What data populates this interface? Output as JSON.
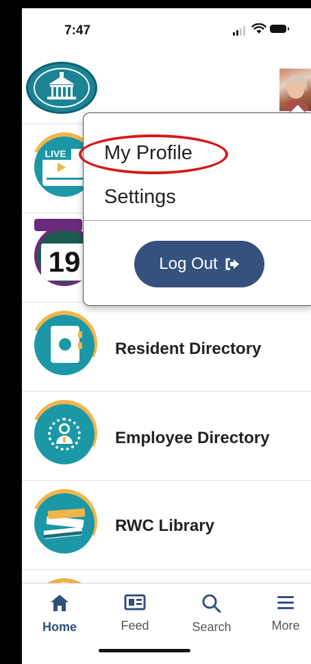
{
  "status_bar": {
    "time": "7:47"
  },
  "menu": {
    "profile_label": "My Profile",
    "settings_label": "Settings",
    "logout_label": "Log Out"
  },
  "list": {
    "items": [
      {
        "label": "",
        "icon": "live-video-icon"
      },
      {
        "label": "",
        "icon": "calendar-icon"
      },
      {
        "label": "Resident Directory",
        "icon": "address-book-icon"
      },
      {
        "label": "Employee Directory",
        "icon": "employee-badge-icon"
      },
      {
        "label": "RWC Library",
        "icon": "books-icon"
      }
    ],
    "live_badge": "LIVE",
    "calendar_day": "19"
  },
  "tabbar": {
    "tabs": [
      {
        "label": "Home",
        "icon": "home-icon",
        "active": true
      },
      {
        "label": "Feed",
        "icon": "newspaper-icon",
        "active": false
      },
      {
        "label": "Search",
        "icon": "search-icon",
        "active": false
      },
      {
        "label": "More",
        "icon": "hamburger-icon",
        "active": false
      }
    ]
  },
  "colors": {
    "accent": "#35527e",
    "teal": "#1c97a6",
    "ring": "#f2b54a",
    "annotation": "#d41a1a"
  }
}
